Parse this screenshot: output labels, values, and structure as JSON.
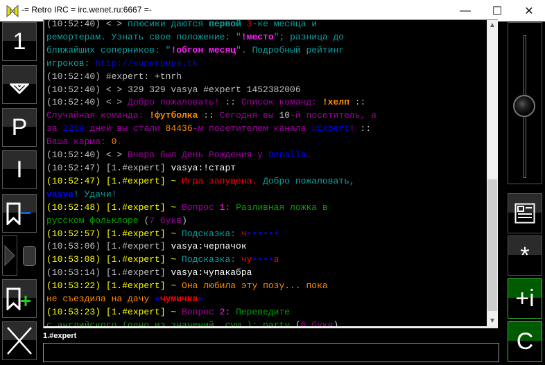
{
  "window": {
    "title": "-= Retro IRC = irc.wenet.ru:6667 =-",
    "minimize": "—",
    "maximize": "☐",
    "close": "✕"
  },
  "left_buttons": [
    {
      "name": "window-1-button",
      "label": "1"
    },
    {
      "name": "collapse-button",
      "icon": "chevron-down-icon"
    },
    {
      "name": "private-button",
      "label": "P"
    },
    {
      "name": "info-button",
      "label": "I"
    },
    {
      "name": "remove-bookmark-button",
      "icon": "bookmark-minus-icon"
    },
    {
      "name": "play-button",
      "icon": "play-triangle-icon"
    },
    {
      "name": "mouse-button",
      "icon": "mouse-icon"
    },
    {
      "name": "add-bookmark-button",
      "icon": "bookmark-plus-icon"
    },
    {
      "name": "close-channel-button",
      "icon": "close-x-icon"
    }
  ],
  "right_buttons": [
    {
      "name": "volume-slider",
      "icon": "slider-knob-icon",
      "level": 0.5
    },
    {
      "name": "news-button",
      "icon": "news-icon"
    },
    {
      "name": "star-button",
      "label": "*"
    },
    {
      "name": "invite-button",
      "label": "+i"
    },
    {
      "name": "clear-button",
      "label": "C"
    }
  ],
  "colors": {
    "grey": "#c0c0c0",
    "white": "#ffffff",
    "yellow": "#ffff00",
    "teal": "#10a0a0",
    "magenta": "#ff20ff",
    "purple": "#a000a0",
    "orange": "#ff8c00",
    "blue": "#0000ff",
    "green": "#00a000",
    "red": "#ff0000"
  },
  "chat_lines": [
    [
      {
        "t": "(10:52:40) < > ",
        "c": "grey"
      },
      {
        "t": "плюсики даются ",
        "c": "teal"
      },
      {
        "t": "первой ",
        "c": "teal",
        "b": 1
      },
      {
        "t": "3",
        "c": "red"
      },
      {
        "t": "-ке месяца и",
        "c": "teal"
      }
    ],
    [
      {
        "t": "ремортерам. Узнать свое положение: \"",
        "c": "teal"
      },
      {
        "t": "!место",
        "c": "magenta",
        "b": 1
      },
      {
        "t": "\"; разница до",
        "c": "teal"
      }
    ],
    [
      {
        "t": "ближайших соперников: \"",
        "c": "teal"
      },
      {
        "t": "!обгон месяц",
        "c": "magenta",
        "b": 1
      },
      {
        "t": "\". Подробный рейтинг",
        "c": "teal"
      }
    ],
    [
      {
        "t": "игроков: ",
        "c": "teal"
      },
      {
        "t": "http://superpups.tk",
        "c": "blue"
      }
    ],
    [
      {
        "t": "(10:52:40) #expert: +tnrh",
        "c": "grey"
      }
    ],
    [
      {
        "t": "(10:52:40) < > 329 329 vasya #expert 1452382006",
        "c": "grey"
      }
    ],
    [
      {
        "t": "(10:52:40) < > ",
        "c": "grey"
      },
      {
        "t": "Добро пожаловать! ",
        "c": "purple"
      },
      {
        "t": ":: ",
        "c": "grey"
      },
      {
        "t": "Список команд: ",
        "c": "purple"
      },
      {
        "t": "!хелп",
        "c": "orange",
        "b": 1
      },
      {
        "t": " ::",
        "c": "grey"
      }
    ],
    [
      {
        "t": "Случайная команда: ",
        "c": "purple"
      },
      {
        "t": "!футболка",
        "c": "orange",
        "b": 1
      },
      {
        "t": " :: ",
        "c": "grey"
      },
      {
        "t": "Сегодня вы ",
        "c": "purple"
      },
      {
        "t": "10",
        "c": "grey"
      },
      {
        "t": "-й посетитель, а",
        "c": "purple"
      }
    ],
    [
      {
        "t": "за ",
        "c": "purple"
      },
      {
        "t": "2239",
        "c": "blue"
      },
      {
        "t": " дней вы стали ",
        "c": "purple"
      },
      {
        "t": "84436",
        "c": "orange"
      },
      {
        "t": "-м посетителем канала ",
        "c": "purple"
      },
      {
        "t": "#Expert",
        "c": "blue"
      },
      {
        "t": "! ",
        "c": "purple"
      },
      {
        "t": "::",
        "c": "grey"
      }
    ],
    [
      {
        "t": "Ваша карма: ",
        "c": "purple"
      },
      {
        "t": "0",
        "c": "orange"
      },
      {
        "t": ".",
        "c": "purple"
      }
    ],
    [
      {
        "t": "(10:52:40) < > ",
        "c": "grey"
      },
      {
        "t": "Вчера был День Рождения у ",
        "c": "purple"
      },
      {
        "t": "Denalla",
        "c": "blue"
      },
      {
        "t": ".",
        "c": "purple"
      }
    ],
    [
      {
        "t": "(10:52:47) [1.#expert] ",
        "c": "grey"
      },
      {
        "t": "vasya:!старт",
        "c": "white"
      }
    ],
    [
      {
        "t": "(10:52:47) [1.#expert] ~ ",
        "c": "yellow"
      },
      {
        "t": "Игра запущена. ",
        "c": "red"
      },
      {
        "t": "Добро пожаловать,",
        "c": "teal"
      }
    ],
    [
      {
        "t": "vasya",
        "c": "blue",
        "b": 1
      },
      {
        "t": "! Удачи!",
        "c": "teal"
      }
    ],
    [
      {
        "t": "(10:52:48) [1.#expert] ~ ",
        "c": "yellow"
      },
      {
        "t": "Вопрос ",
        "c": "purple"
      },
      {
        "t": "1: ",
        "c": "magenta"
      },
      {
        "t": "Разливная ложка в",
        "c": "green"
      }
    ],
    [
      {
        "t": "русском фольклоре ",
        "c": "green"
      },
      {
        "t": "(",
        "c": "grey"
      },
      {
        "t": "7 букв",
        "c": "purple"
      },
      {
        "t": ")",
        "c": "grey"
      }
    ],
    [
      {
        "t": "(10:52:57) [1.#expert] ~ ",
        "c": "yellow"
      },
      {
        "t": "Подсказка: ",
        "c": "teal"
      },
      {
        "t": "ч",
        "c": "red"
      },
      {
        "t": "••••••",
        "c": "blue"
      }
    ],
    [
      {
        "t": "(10:53:06) [1.#expert] ",
        "c": "grey"
      },
      {
        "t": "vasya:черпачок",
        "c": "white"
      }
    ],
    [
      {
        "t": "(10:53:08) [1.#expert] ~ ",
        "c": "yellow"
      },
      {
        "t": "Подсказка: ",
        "c": "teal"
      },
      {
        "t": "чу",
        "c": "red"
      },
      {
        "t": "••••",
        "c": "blue"
      },
      {
        "t": "а",
        "c": "red"
      }
    ],
    [
      {
        "t": "(10:53:14) [1.#expert] ",
        "c": "grey"
      },
      {
        "t": "vasya:чупакабра",
        "c": "white"
      }
    ],
    [
      {
        "t": "(10:53:22) [1.#expert] ~ ",
        "c": "yellow"
      },
      {
        "t": "Она любила эту позу... пока",
        "c": "orange"
      }
    ],
    [
      {
        "t": "не съездила на дачу ",
        "c": "orange"
      },
      {
        "t": "«",
        "c": "blue",
        "b": 1
      },
      {
        "t": "чумичка",
        "c": "red",
        "b": 1
      },
      {
        "t": "»",
        "c": "blue",
        "b": 1
      }
    ],
    [
      {
        "t": "(10:53:23) [1.#expert] ~ ",
        "c": "yellow"
      },
      {
        "t": "Вопрос ",
        "c": "purple"
      },
      {
        "t": "2: ",
        "c": "magenta"
      },
      {
        "t": "Переведите",
        "c": "green"
      }
    ],
    [
      {
        "t": "с английского (одно из значений, сущ.): party ",
        "c": "green"
      },
      {
        "t": "(",
        "c": "grey"
      },
      {
        "t": "6 букв",
        "c": "purple"
      },
      {
        "t": ")",
        "c": "grey"
      }
    ]
  ],
  "channel_label": "1.#expert",
  "input": {
    "value": "",
    "placeholder": ""
  }
}
